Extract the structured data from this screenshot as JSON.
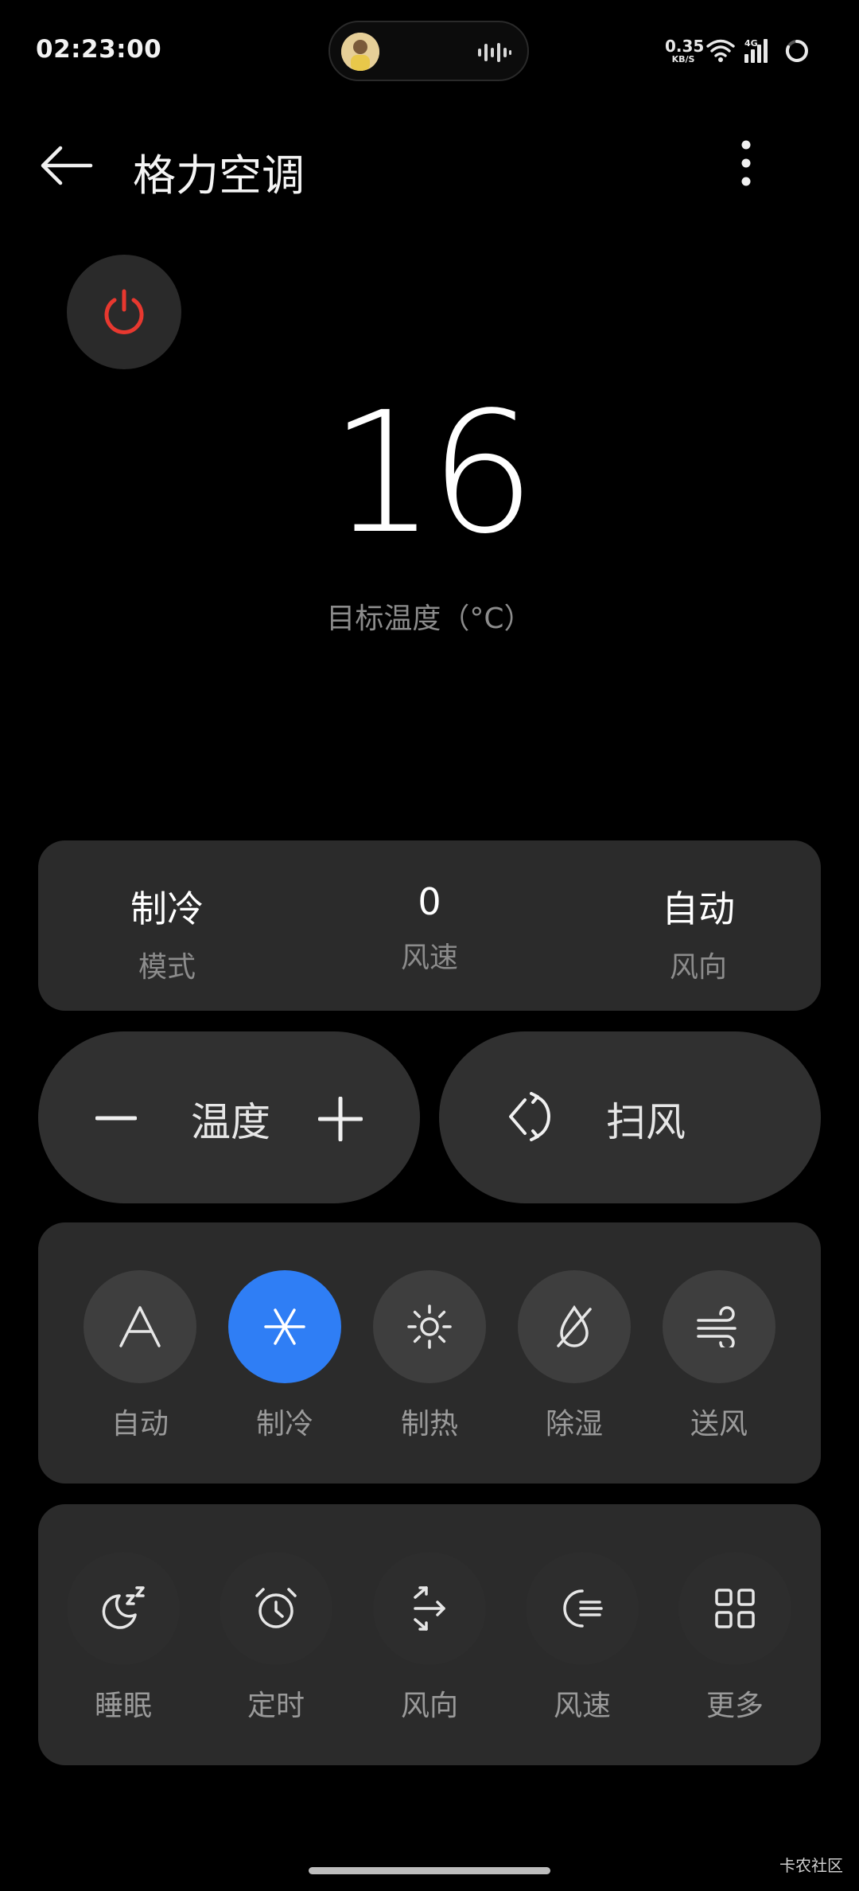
{
  "status_bar": {
    "time": "02:23:00",
    "net_speed_value": "0.35",
    "net_speed_unit": "KB/S",
    "network_type": "4G"
  },
  "header": {
    "title": "格力空调"
  },
  "temperature": {
    "value": "16",
    "caption": "目标温度（°C）"
  },
  "status_card": [
    {
      "value": "制冷",
      "label": "模式"
    },
    {
      "value": "0",
      "label": "风速"
    },
    {
      "value": "自动",
      "label": "风向"
    }
  ],
  "controls": {
    "temp_label": "温度",
    "swing_label": "扫风"
  },
  "modes": [
    {
      "label": "自动",
      "icon": "auto-mode-icon",
      "active": false
    },
    {
      "label": "制冷",
      "icon": "snowflake-icon",
      "active": true
    },
    {
      "label": "制热",
      "icon": "sun-icon",
      "active": false
    },
    {
      "label": "除湿",
      "icon": "dehumidify-icon",
      "active": false
    },
    {
      "label": "送风",
      "icon": "fan-wind-icon",
      "active": false
    }
  ],
  "functions": [
    {
      "label": "睡眠",
      "icon": "sleep-moon-icon"
    },
    {
      "label": "定时",
      "icon": "alarm-clock-icon"
    },
    {
      "label": "风向",
      "icon": "wind-direction-icon"
    },
    {
      "label": "风速",
      "icon": "wind-speed-icon"
    },
    {
      "label": "更多",
      "icon": "grid-icon"
    }
  ],
  "colors": {
    "accent": "#2f7ef5",
    "power": "#e8382f",
    "background": "#000000",
    "card": "#2b2b2b"
  },
  "watermark": "卡农社区"
}
